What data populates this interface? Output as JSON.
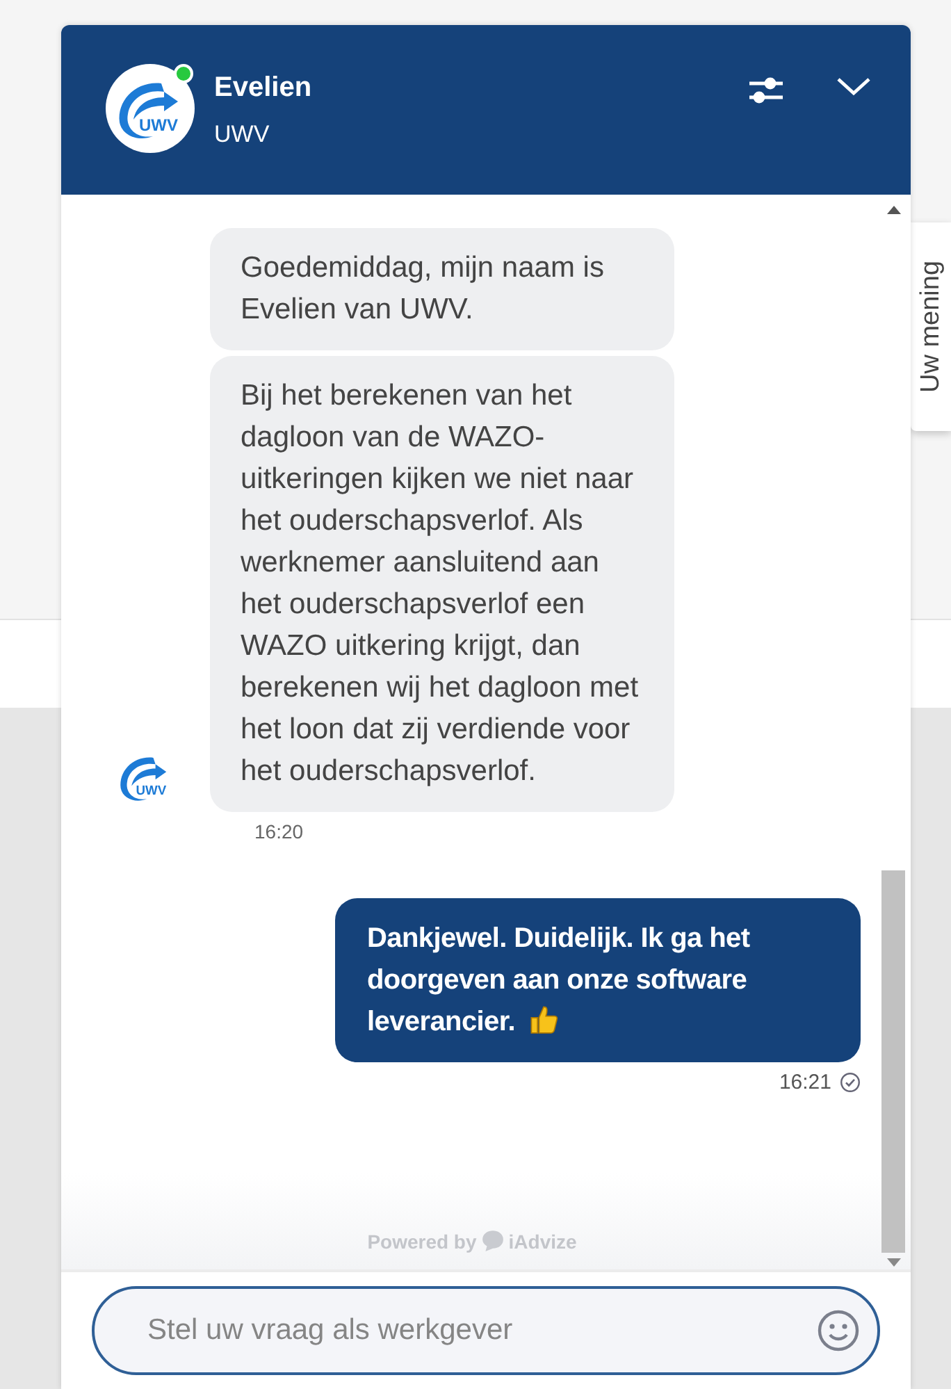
{
  "header": {
    "agent_name": "Evelien",
    "organisation": "UWV",
    "logo_text": "UWV",
    "online": true
  },
  "feedback_tab": {
    "label": "Uw mening"
  },
  "messages": [
    {
      "kind": "agent",
      "text": "Goedemiddag, mijn naam is Evelien van UWV."
    },
    {
      "kind": "agent",
      "text": "Bij het berekenen van het dagloon van de WAZO-uitkeringen kijken we niet naar het ouderschapsverlof. Als werknemer aansluitend aan het ouderschapsverlof een WAZO uitkering krijgt, dan berekenen wij het dagloon met het loon dat zij verdiende voor het ouderschapsverlof.",
      "avatar_text": "UWV",
      "time": "16:20"
    },
    {
      "kind": "user",
      "text": "Dankjewel. Duidelijk. Ik ga het doorgeven aan onze software leverancier.",
      "thumbs_up": true,
      "time": "16:21",
      "read": true
    }
  ],
  "powered_by": {
    "label": "Powered by",
    "brand": "iAdvize"
  },
  "composer": {
    "placeholder": "Stel uw vraag als werkgever"
  }
}
